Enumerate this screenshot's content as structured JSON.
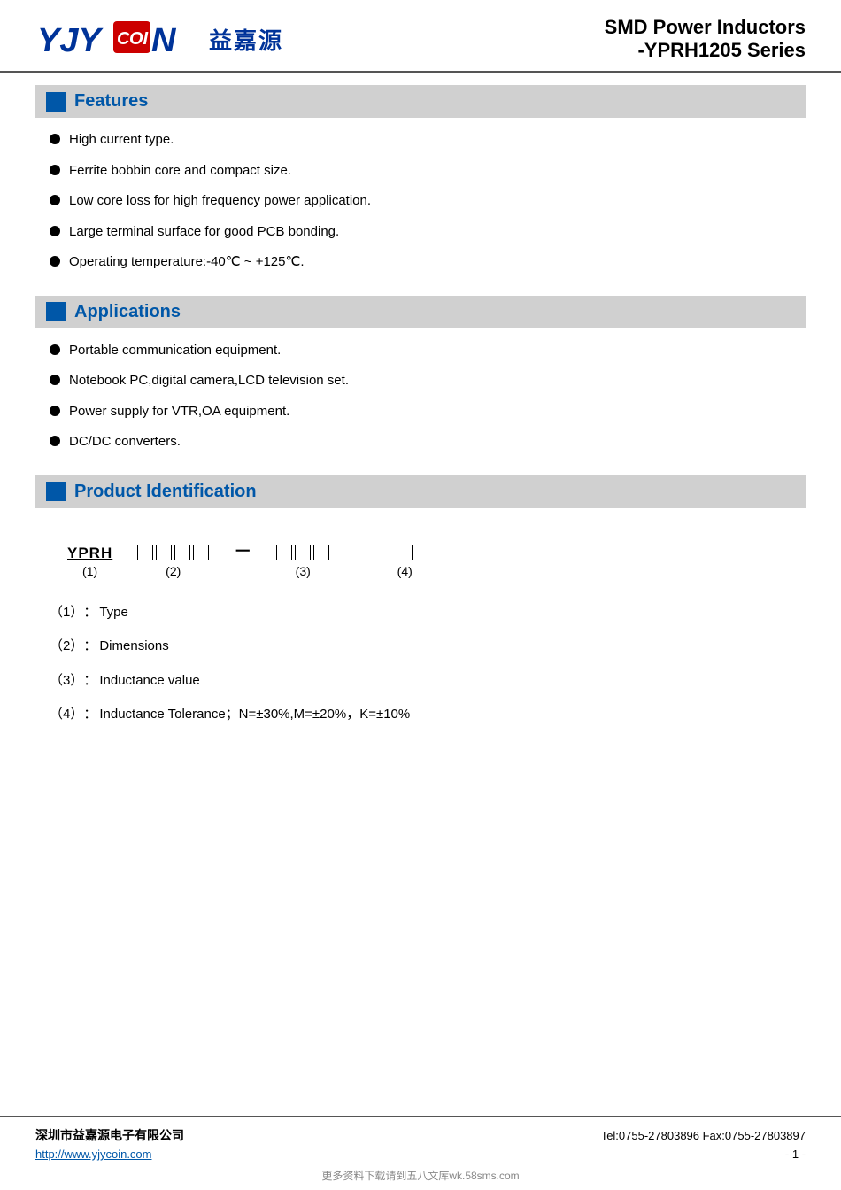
{
  "header": {
    "logo_text_blue": "YJYCOIN",
    "logo_cn": "益嘉源",
    "title_line1": "SMD Power Inductors",
    "title_line2": "-YPRH1205 Series"
  },
  "features": {
    "section_label": "Features",
    "items": [
      "High current type.",
      "Ferrite bobbin core and compact size.",
      "Low core loss for high frequency power application.",
      "Large terminal surface for good PCB bonding.",
      "Operating temperature:-40℃  ~ +125℃."
    ]
  },
  "applications": {
    "section_label": "Applications",
    "items": [
      "Portable communication equipment.",
      "Notebook PC,digital camera,LCD television set.",
      "Power supply for VTR,OA equipment.",
      "DC/DC converters."
    ]
  },
  "product_identification": {
    "section_label": "Product Identification",
    "code_prefix": "YPRH",
    "code_prefix_label": "(1)",
    "code_part2_boxes": 4,
    "code_part2_label": "(2)",
    "code_part3_boxes": 3,
    "code_part3_label": "(3)",
    "code_part4_boxes": 1,
    "code_part4_label": "(4)",
    "items": [
      {
        "num": "（1）",
        "colon": "：",
        "desc": "Type"
      },
      {
        "num": "（2）",
        "colon": "：",
        "desc": "Dimensions"
      },
      {
        "num": "（3）",
        "colon": "：",
        "desc": "Inductance value"
      },
      {
        "num": "（4）",
        "colon": "：",
        "desc": "Inductance Tolerance；N=±30%,M=±20%，K=±10%"
      }
    ]
  },
  "footer": {
    "company": "深圳市益嘉源电子有限公司",
    "contact": "Tel:0755-27803896   Fax:0755-27803897",
    "link": "http://www.yjycoin.com",
    "page": "- 1 -",
    "watermark": "更多资料下载请到五八文库wk.58sms.com"
  }
}
